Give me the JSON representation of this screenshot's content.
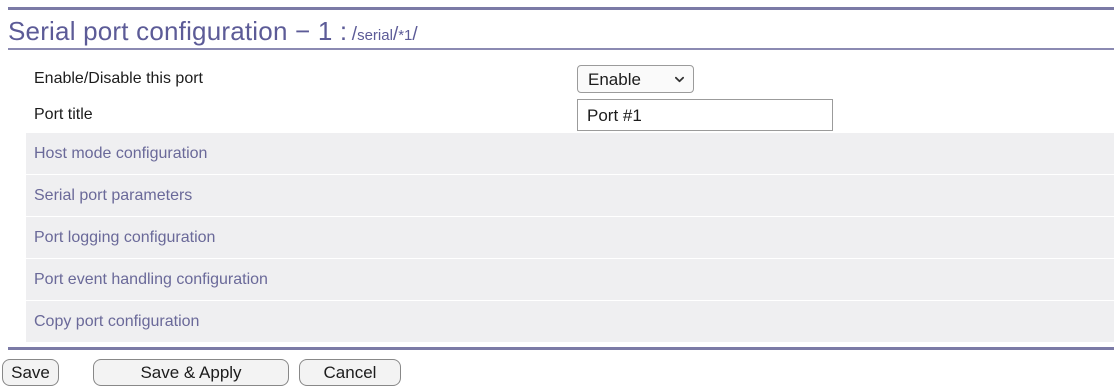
{
  "header": {
    "title": "Serial port configuration − 1 :",
    "path_prefix": "/",
    "path_1": "serial",
    "path_sep": "/",
    "path_2": "*1",
    "path_suffix": "/"
  },
  "settings": {
    "enable_label": "Enable/Disable this port",
    "enable_value": "Enable",
    "title_label": "Port title",
    "title_value": "Port #1"
  },
  "sections": [
    "Host mode configuration",
    "Serial port parameters",
    "Port logging configuration",
    "Port event handling configuration",
    "Copy port configuration"
  ],
  "buttons": {
    "save": "Save",
    "save_apply": "Save & Apply",
    "cancel": "Cancel"
  },
  "colors": {
    "accent": "#5c5b97",
    "rule": "#7b7aa6",
    "section_bg": "#efeff1"
  },
  "icons": {
    "select": "chevron-down-icon"
  }
}
